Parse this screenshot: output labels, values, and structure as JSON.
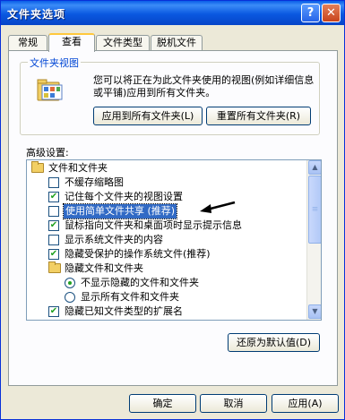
{
  "window": {
    "title": "文件夹选项",
    "help_glyph": "?",
    "close_glyph": "✕"
  },
  "tabs": [
    {
      "label": "常规"
    },
    {
      "label": "查看"
    },
    {
      "label": "文件类型"
    },
    {
      "label": "脱机文件"
    }
  ],
  "folder_views": {
    "title": "文件夹视图",
    "description": "您可以将正在为此文件夹使用的视图(例如详细信息或平铺)应用到所有文件夹。",
    "apply_button": "应用到所有文件夹(L)",
    "reset_button": "重置所有文件夹(R)"
  },
  "advanced": {
    "label": "高级设置:",
    "items": [
      {
        "type": "folder",
        "label": "文件和文件夹"
      },
      {
        "type": "checkbox",
        "checked": false,
        "label": "不缓存缩略图"
      },
      {
        "type": "checkbox",
        "checked": true,
        "label": "记住每个文件夹的视图设置"
      },
      {
        "type": "checkbox",
        "checked": false,
        "label": "使用简单文件共享 (推荐)",
        "selected": true
      },
      {
        "type": "checkbox",
        "checked": true,
        "label": "鼠标指向文件夹和桌面项时显示提示信息"
      },
      {
        "type": "checkbox",
        "checked": false,
        "label": "显示系统文件夹的内容"
      },
      {
        "type": "checkbox",
        "checked": true,
        "label": "隐藏受保护的操作系统文件(推荐)"
      },
      {
        "type": "folder",
        "label": "隐藏文件和文件夹"
      },
      {
        "type": "radio",
        "checked": true,
        "label": "不显示隐藏的文件和文件夹"
      },
      {
        "type": "radio",
        "checked": false,
        "label": "显示所有文件和文件夹"
      },
      {
        "type": "checkbox",
        "checked": true,
        "label": "隐藏已知文件类型的扩展名"
      }
    ],
    "restore_button": "还原为默认值(D)"
  },
  "footer": {
    "ok": "确定",
    "cancel": "取消",
    "apply": "应用(A)"
  },
  "colors": {
    "title_bar": "#0a58e0",
    "selection": "#316ac5",
    "check": "#21a121",
    "arrow": "#000000"
  }
}
